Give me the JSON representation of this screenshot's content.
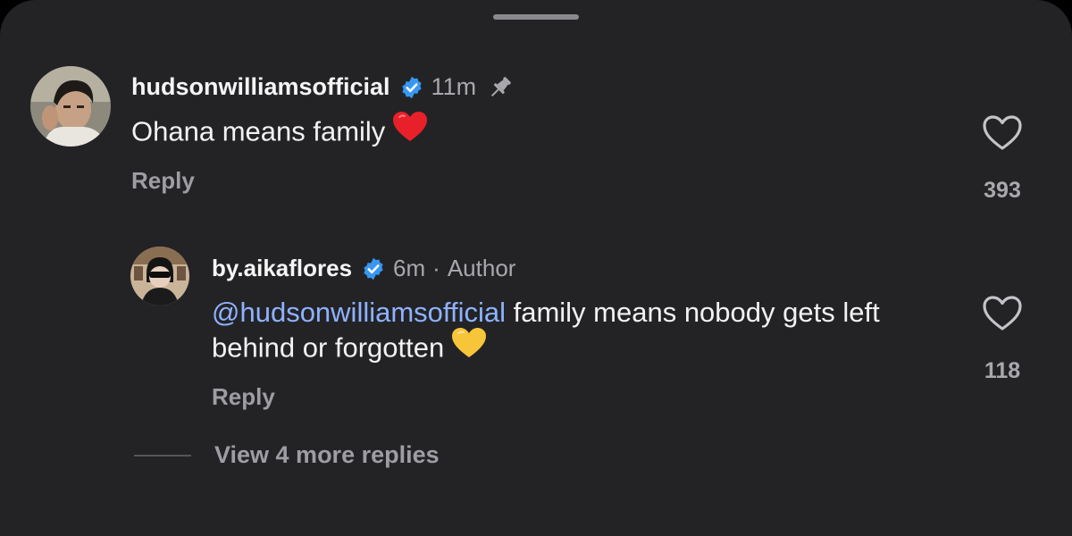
{
  "colors": {
    "background": "#232326",
    "verified_badge": "#3897f0",
    "mention": "#8fb2ff",
    "muted_text": "#a8a8ad"
  },
  "comments": [
    {
      "username": "hudsonwilliamsofficial",
      "verified": true,
      "time": "11m",
      "pinned": true,
      "text": "Ohana means family",
      "emoji": "red-heart",
      "reply_label": "Reply",
      "like_count": "393",
      "replies": [
        {
          "username": "by.aikaflores",
          "verified": true,
          "time": "6m",
          "separator": "·",
          "author_tag": "Author",
          "mention": "@hudsonwilliamsofficial",
          "text": " family means nobody gets left behind or forgotten",
          "emoji": "yellow-heart",
          "reply_label": "Reply",
          "like_count": "118"
        }
      ],
      "view_more_label": "View 4 more replies"
    }
  ]
}
